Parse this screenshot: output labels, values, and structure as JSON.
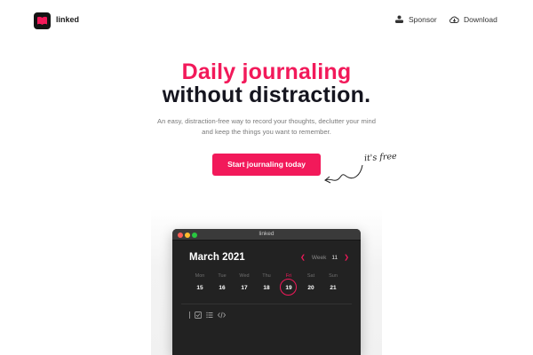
{
  "nav": {
    "brand": "linked",
    "sponsor_label": "Sponsor",
    "download_label": "Download",
    "icons": [
      "book-logo-icon",
      "sponsor-icon",
      "download-icon"
    ]
  },
  "hero": {
    "headline_accent": "Daily journaling",
    "headline_main": "without distraction.",
    "subtitle": "An easy, distraction-free way to record your thoughts, declutter your mind and keep the things you want to remember.",
    "cta_label": "Start journaling today",
    "free_note": "it's free"
  },
  "colors": {
    "accent": "#f2195a",
    "dark": "#15151f",
    "window_bg": "#222222"
  },
  "app": {
    "window_title": "linked",
    "month": "March 2021",
    "week_label": "Week",
    "week_number": "11",
    "days": [
      {
        "name": "Mon",
        "num": "15"
      },
      {
        "name": "Tue",
        "num": "16"
      },
      {
        "name": "Wed",
        "num": "17"
      },
      {
        "name": "Thu",
        "num": "18"
      },
      {
        "name": "Fri",
        "num": "19"
      },
      {
        "name": "Sat",
        "num": "20"
      },
      {
        "name": "Sun",
        "num": "21"
      }
    ],
    "selected_day": "19",
    "toolbar_icons": [
      "checkbox-icon",
      "list-icon",
      "code-icon"
    ]
  }
}
